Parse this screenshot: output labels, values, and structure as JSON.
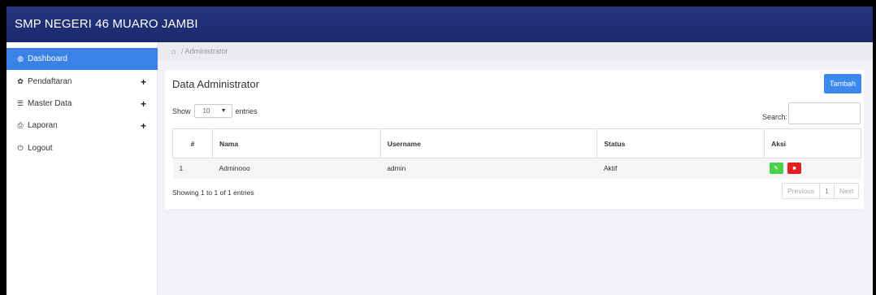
{
  "app": {
    "title": "SMP NEGERI 46 MUARO JAMBI"
  },
  "sidebar": {
    "items": [
      {
        "label": "Dashboard",
        "icon": "dashboard-icon",
        "glyph": "◍",
        "expandable": false,
        "active": true
      },
      {
        "label": "Pendaftaran",
        "icon": "gear-icon",
        "glyph": "✿",
        "expandable": true,
        "active": false
      },
      {
        "label": "Master Data",
        "icon": "database-icon",
        "glyph": "☰",
        "expandable": true,
        "active": false
      },
      {
        "label": "Laporan",
        "icon": "print-icon",
        "glyph": "⎙",
        "expandable": true,
        "active": false
      },
      {
        "label": "Logout",
        "icon": "power-icon",
        "glyph": "⏻",
        "expandable": false,
        "active": false
      }
    ],
    "expand_glyph": "+"
  },
  "breadcrumb": {
    "home_glyph": "⌂",
    "separator": "/",
    "current": "Administrator"
  },
  "card": {
    "title": "Data Administrator",
    "add_button": "Tambah",
    "show_label": "Show",
    "entries_value": "10",
    "entries_label": "entries",
    "search_label": "Search:",
    "search_value": "",
    "table": {
      "headers": [
        "#",
        "Nama",
        "Username",
        "Status",
        "Aksi"
      ],
      "rows": [
        {
          "num": "1",
          "nama": "Adminooo",
          "username": "admin",
          "status": "Aktif"
        }
      ]
    },
    "info": "Showing 1 to 1 of 1 entries",
    "pagination": {
      "previous": "Previous",
      "page": "1",
      "next": "Next"
    }
  },
  "colors": {
    "topbar": "#1b2a6d",
    "active_nav": "#3b82e8",
    "primary_button": "#3b88f0",
    "edit_button": "#4cd04c",
    "delete_button": "#e02020"
  }
}
